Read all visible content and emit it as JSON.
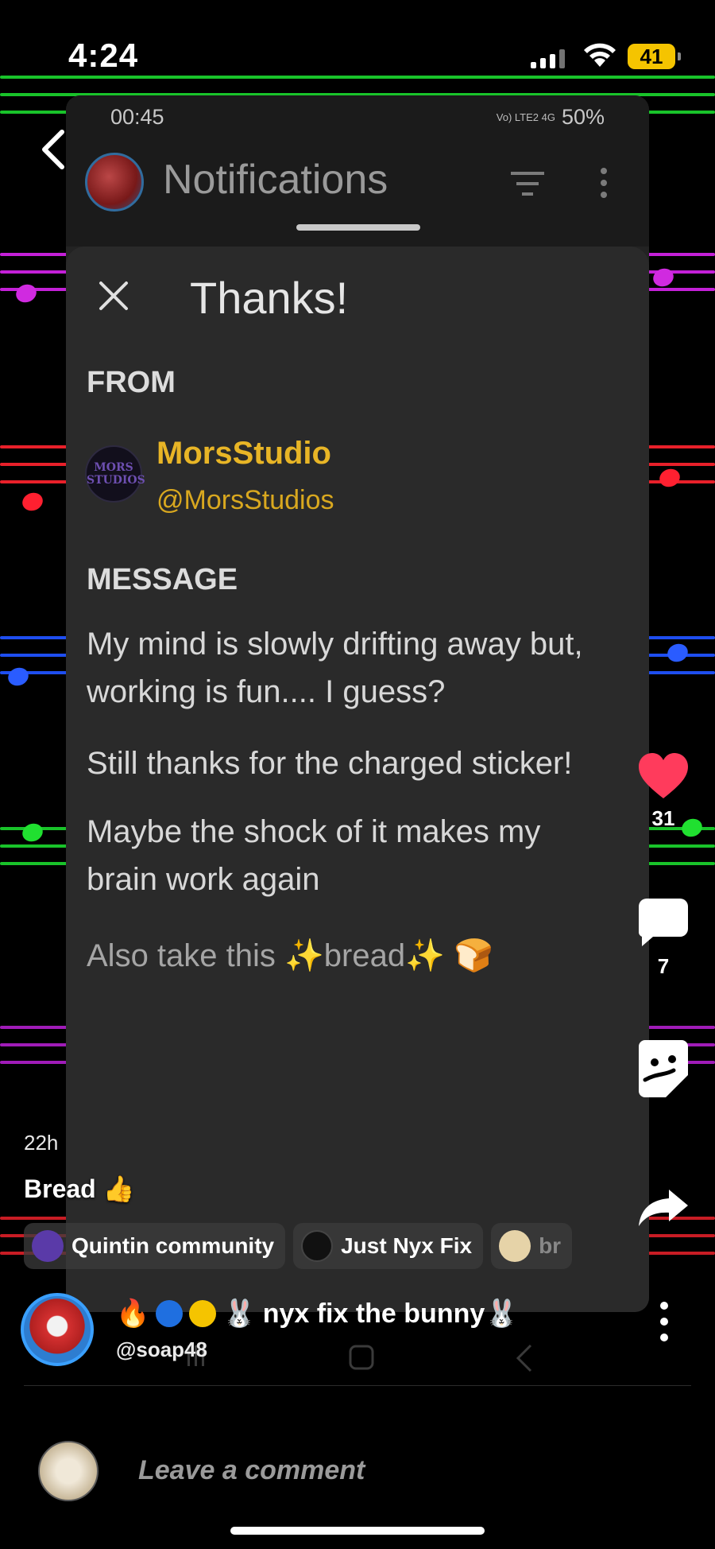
{
  "ios_status": {
    "time": "4:24",
    "battery": "41"
  },
  "notifications_screen": {
    "status_time": "00:45",
    "status_right": "50%",
    "network": "Vo) LTE2 4G",
    "title": "Notifications"
  },
  "sheet": {
    "title": "Thanks!",
    "from_label": "FROM",
    "sender_name": "MorsStudio",
    "sender_handle": "@MorsStudios",
    "sender_avatar_text": "MORS STUDIOS",
    "message_label": "MESSAGE",
    "message_lines": [
      "My mind is slowly drifting away but, working is fun.... I guess?",
      "Still thanks for the charged sticker!",
      "Maybe the shock of it makes my brain work again",
      "Also take this ✨bread✨ 🍞"
    ]
  },
  "rail": {
    "like_count": "31",
    "comment_count": "7"
  },
  "post": {
    "time_ago": "22h",
    "caption": "Bread 👍",
    "chips": [
      {
        "label": "Quintin community",
        "color": "#5a3aa8"
      },
      {
        "label": "Just Nyx Fix",
        "color": "#111111"
      },
      {
        "label": "br",
        "color": "#e6d3a8"
      }
    ],
    "title_emoji": "🔥",
    "title_text": "nyx fix the bunny🐰",
    "title_rabbit": "🐰",
    "author_handle": "@soap48"
  },
  "comment": {
    "placeholder": "Leave a comment"
  },
  "colors": {
    "accent_gold": "#e8b526",
    "like_red": "#ff3b5c"
  }
}
